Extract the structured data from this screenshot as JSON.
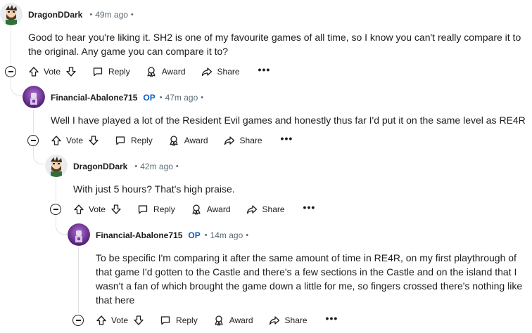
{
  "comments": [
    {
      "author": "DragonDDark",
      "op_badge": "",
      "time": "49m ago",
      "body_lines": [
        "Good to hear you're liking it. SH2 is one of my favourite games of all time, so I know you can't really compare it to",
        "the original. Any game you can compare it to?"
      ]
    },
    {
      "author": "Financial-Abalone715",
      "op_badge": "OP",
      "time": "47m ago",
      "body_lines": [
        "Well I have played a lot of the Resident Evil games and honestly thus far I'd put it on the same level as RE4R"
      ]
    },
    {
      "author": "DragonDDark",
      "op_badge": "",
      "time": "42m ago",
      "body_lines": [
        "With just 5 hours? That's high praise."
      ]
    },
    {
      "author": "Financial-Abalone715",
      "op_badge": "OP",
      "time": "14m ago",
      "body_lines": [
        "To be specific I'm comparing it after the same amount of time in RE4R, on my first playthrough of",
        "that game I'd gotten to the Castle and there's a few sections in the Castle and on the island that I",
        "wasn't a fan of which brought the game down a little for me, so fingers crossed there's nothing like",
        "that here"
      ]
    }
  ],
  "actions": {
    "vote": "Vote",
    "reply": "Reply",
    "award": "Award",
    "share": "Share",
    "more": "•••"
  },
  "separator": "•",
  "icons": [
    "collapse-icon",
    "upvote-icon",
    "downvote-icon",
    "reply-icon",
    "award-icon",
    "share-icon",
    "more-icon"
  ],
  "colors": {
    "text": "#1c1c1c",
    "meta": "#5c6c74",
    "op": "#0a5cc2",
    "thread_line": "#e0e4e6"
  }
}
